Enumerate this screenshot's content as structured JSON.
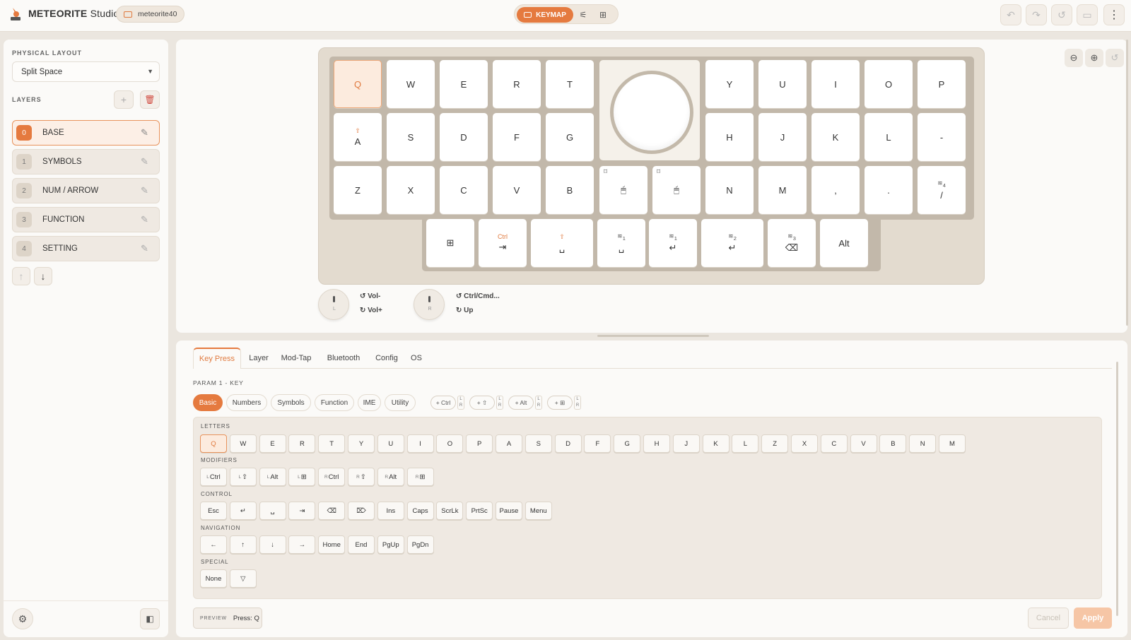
{
  "app": {
    "brand": "METEORITE",
    "suffix": " Studio",
    "device": "meteorite40",
    "mode_label": "KEYMAP"
  },
  "sidebar": {
    "physical_layout_label": "PHYSICAL LAYOUT",
    "physical_layout_value": "Split Space",
    "layers_label": "LAYERS",
    "layers": [
      {
        "num": "0",
        "name": "BASE"
      },
      {
        "num": "1",
        "name": "SYMBOLS"
      },
      {
        "num": "2",
        "name": "NUM / ARROW"
      },
      {
        "num": "3",
        "name": "FUNCTION"
      },
      {
        "num": "4",
        "name": "SETTING"
      }
    ]
  },
  "keyboard": {
    "row1_left": [
      "Q",
      "W",
      "E",
      "R",
      "T"
    ],
    "row1_right": [
      "Y",
      "U",
      "I",
      "O",
      "P"
    ],
    "row2_left": [
      "A",
      "S",
      "D",
      "F",
      "G"
    ],
    "row2_right": [
      "H",
      "J",
      "K",
      "L",
      "-"
    ],
    "row3_left": [
      "Z",
      "X",
      "C",
      "V",
      "B"
    ],
    "row3_right": [
      "N",
      "M",
      ",",
      ".",
      "/"
    ],
    "thumb_ctrl_label": "Ctrl",
    "thumb_alt": "Alt",
    "layer_subscripts": [
      "1",
      "1",
      "2",
      "3",
      "4"
    ]
  },
  "encoders": {
    "left": {
      "letter": "L",
      "ccw": "Vol-",
      "cw": "Vol+"
    },
    "right": {
      "letter": "R",
      "ccw": "Ctrl/Cmd...",
      "cw": "Up"
    }
  },
  "editor": {
    "tabs": [
      "Key Press",
      "Layer",
      "Mod-Tap",
      "Bluetooth",
      "Config",
      "OS"
    ],
    "param_label": "PARAM 1 - KEY",
    "categories": [
      "Basic",
      "Numbers",
      "Symbols",
      "Function",
      "IME",
      "Utility"
    ],
    "mod_chips": [
      "+ Ctrl",
      "+ ⇧",
      "+ Alt",
      "+ ⊞"
    ],
    "lr": [
      "L",
      "R"
    ],
    "groups": {
      "letters": {
        "label": "LETTERS",
        "keys": [
          "Q",
          "W",
          "E",
          "R",
          "T",
          "Y",
          "U",
          "I",
          "O",
          "P",
          "A",
          "S",
          "D",
          "F",
          "G",
          "H",
          "J",
          "K",
          "L",
          "Z",
          "X",
          "C",
          "V",
          "B",
          "N",
          "M"
        ]
      },
      "modifiers": {
        "label": "MODIFIERS",
        "keys": [
          [
            "L",
            "Ctrl"
          ],
          [
            "L",
            "⇧"
          ],
          [
            "L",
            "Alt"
          ],
          [
            "L",
            "⊞"
          ],
          [
            "R",
            "Ctrl"
          ],
          [
            "R",
            "⇧"
          ],
          [
            "R",
            "Alt"
          ],
          [
            "R",
            "⊞"
          ]
        ]
      },
      "control": {
        "label": "CONTROL",
        "keys": [
          "Esc",
          "↵",
          "␣",
          "⇥",
          "⌫",
          "⌦",
          "Ins",
          "Caps",
          "ScrLk",
          "PrtSc",
          "Pause",
          "Menu"
        ]
      },
      "navigation": {
        "label": "NAVIGATION",
        "keys": [
          "←",
          "↑",
          "↓",
          "→",
          "Home",
          "End",
          "PgUp",
          "PgDn"
        ]
      },
      "special": {
        "label": "SPECIAL",
        "keys": [
          "None",
          "▽"
        ]
      }
    },
    "preview_label": "PREVIEW",
    "preview_value": "Press: Q",
    "cancel": "Cancel",
    "apply": "Apply"
  },
  "colors": {
    "accent": "#e57a3f",
    "background": "#ebe6df",
    "panel": "#fbfaf8",
    "keyboard_case": "#e3dbcf"
  }
}
